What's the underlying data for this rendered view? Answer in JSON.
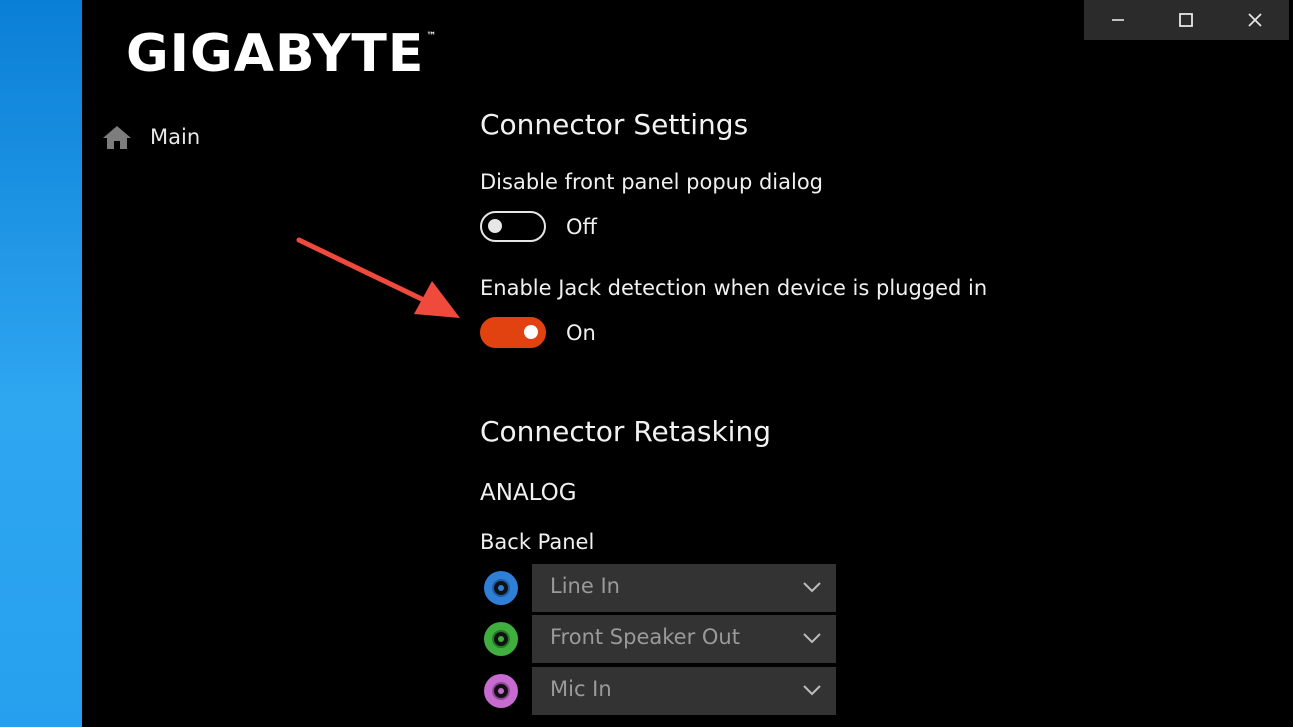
{
  "app": {
    "logo_text": "GIGABYTE",
    "logo_tm": "™"
  },
  "window_controls": {
    "minimize_icon": "minimize-icon",
    "maximize_icon": "maximize-icon",
    "close_icon": "close-icon"
  },
  "nav": {
    "main_label": "Main",
    "main_icon": "home-icon"
  },
  "connector_settings": {
    "title": "Connector Settings",
    "front_panel_popup": {
      "label": "Disable front panel popup dialog",
      "state": "Off"
    },
    "jack_detection": {
      "label": "Enable Jack detection when device is plugged in",
      "state": "On"
    }
  },
  "connector_retasking": {
    "title": "Connector Retasking",
    "section": "ANALOG",
    "subsection": "Back Panel",
    "jacks": [
      {
        "color": "#2f7fd6",
        "value": "Line In"
      },
      {
        "color": "#3fae3f",
        "value": "Front Speaker Out"
      },
      {
        "color": "#c76bd0",
        "value": "Mic In"
      }
    ]
  },
  "colors": {
    "accent": "#e1420f",
    "annotation_arrow": "#ef4a3c",
    "desktop": "#2fa6f0"
  }
}
